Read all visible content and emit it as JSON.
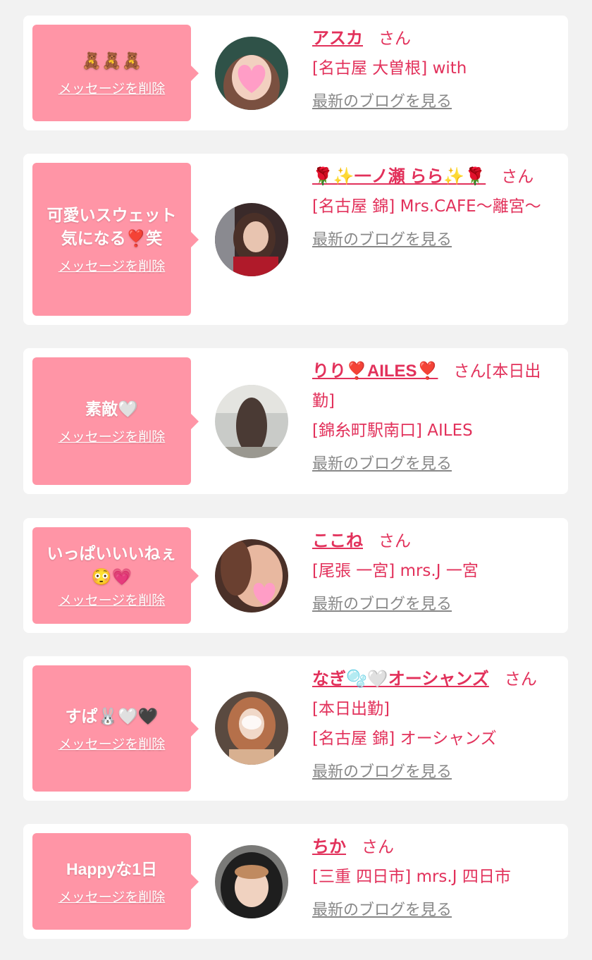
{
  "delete_label": "メッセージを削除",
  "blog_label": "最新のブログを見る",
  "honorific": "さん",
  "colors": {
    "accent": "#e2315b",
    "bubble": "#ff95a6",
    "background": "#f2f2f2",
    "link_gray": "#888888"
  },
  "items": [
    {
      "message": "🧸🧸🧸",
      "name": "アスカ",
      "after_name": "",
      "shop": "[名古屋 大曽根] with",
      "avatar_icon": "heart-sticker-avatar"
    },
    {
      "message": "可愛いスウェット\n気になる❣️笑",
      "name": "🌹✨一ノ瀬 らら✨🌹",
      "after_name": "",
      "shop": "[名古屋 錦] Mrs.CAFE～離宮～",
      "avatar_icon": "woman-avatar"
    },
    {
      "message": "素敵🤍",
      "name": "りり❣️AILES❣️",
      "after_name": "[本日出勤]",
      "shop": "[錦糸町駅南口] AILES",
      "avatar_icon": "woman-back-avatar"
    },
    {
      "message": "いっぱいいいねぇ\n😳💗",
      "name": "ここね",
      "after_name": "",
      "shop": "[尾張 一宮] mrs.J 一宮",
      "avatar_icon": "heart-sticker-avatar"
    },
    {
      "message": "すぱ🐰🤍🖤",
      "name": "なぎ🫧🤍オーシャンズ",
      "after_name": "[本日出勤]",
      "shop": "[名古屋 錦] オーシャンズ",
      "avatar_icon": "woman-avatar"
    },
    {
      "message": "Happyな1日",
      "name": "ちか",
      "after_name": "",
      "shop": "[三重 四日市] mrs.J 四日市",
      "avatar_icon": "hooded-woman-avatar"
    }
  ]
}
